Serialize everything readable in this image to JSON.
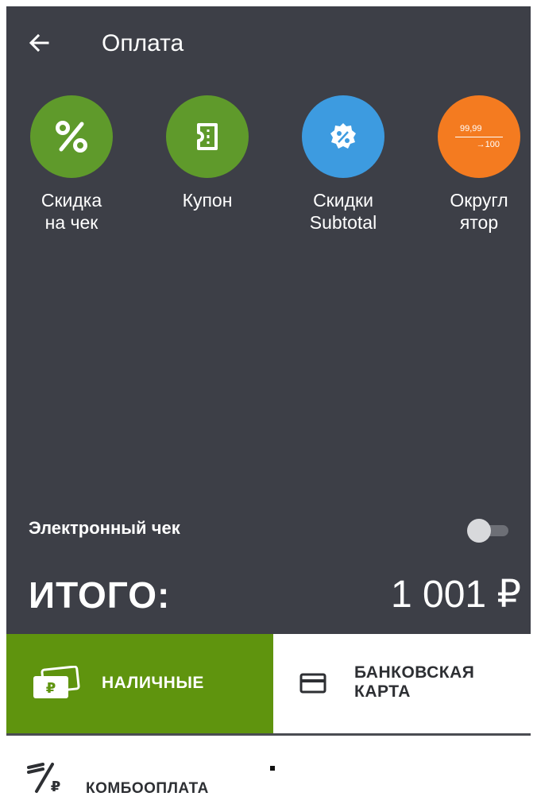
{
  "header": {
    "title": "Оплата"
  },
  "tools": [
    {
      "label": "Скидка\nна чек",
      "icon": "percent-icon",
      "color": "#5f9a2b"
    },
    {
      "label": "Купон",
      "icon": "coupon-icon",
      "color": "#5f9a2b"
    },
    {
      "label": "Скидки\nSubtotal",
      "icon": "subtotal-discount-icon",
      "color": "#3d9be0"
    },
    {
      "label": "Округл\nятор",
      "icon": "rounding-icon",
      "color": "#f47b20",
      "icon_text_top": "99,99",
      "icon_text_bottom": "→100"
    }
  ],
  "ereceipt": {
    "label": "Электронный чек",
    "enabled": false
  },
  "total": {
    "label": "ИТОГО:",
    "value": "1 001 ₽"
  },
  "payments": {
    "cash": {
      "label": "НАЛИЧНЫЕ",
      "color": "#5f940e"
    },
    "card": {
      "label": "БАНКОВСКАЯ\nКАРТА"
    },
    "combo": {
      "label": "КОМБООПЛАТА"
    }
  }
}
